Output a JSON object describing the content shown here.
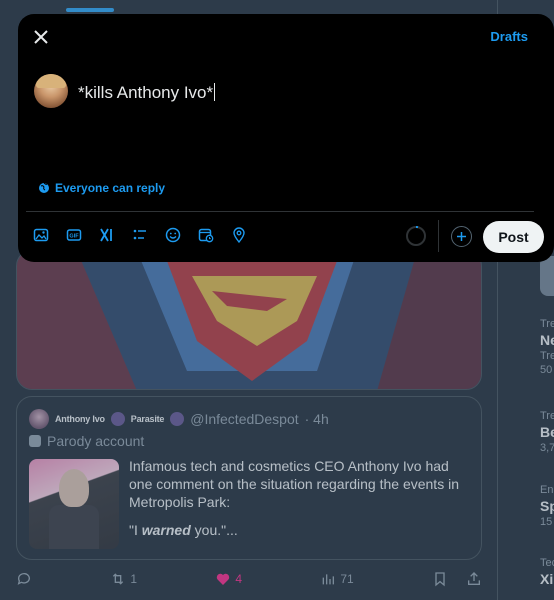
{
  "compose": {
    "text": "*kills Anthony Ivo*",
    "drafts_label": "Drafts",
    "reply_setting": "Everyone can reply",
    "post_label": "Post",
    "toolbar_icons": [
      "image-icon",
      "gif-icon",
      "grok-icon",
      "poll-icon",
      "emoji-icon",
      "schedule-icon",
      "location-icon"
    ]
  },
  "quote": {
    "name": "Anthony Ivo",
    "name_suffix": "Parasite",
    "handle": "@InfectedDespot",
    "time": "· 4h",
    "label": "Parody account",
    "text": "Infamous tech and cosmetics CEO Anthony Ivo had one comment on the situation regarding the events in Metropolis Park:",
    "quote_open": "\"I ",
    "quote_em": "warned",
    "quote_close": " you.\"..."
  },
  "actions": {
    "reposts": "1",
    "likes": "4",
    "views": "71"
  },
  "trends": [
    {
      "meta": "Tre",
      "title": "Ne",
      "sub": "Tre",
      "count": "50"
    },
    {
      "meta": "Tre",
      "title": "Be",
      "sub": "",
      "count": "3,7"
    },
    {
      "meta": "En",
      "title": "Sp",
      "sub": "",
      "count": "15"
    },
    {
      "meta": "Tec",
      "title": "Xi",
      "sub": "",
      "count": ""
    }
  ],
  "colors": {
    "accent": "#1d9bf0",
    "like": "#f91880",
    "background": "#15202b",
    "modal": "#000000"
  }
}
